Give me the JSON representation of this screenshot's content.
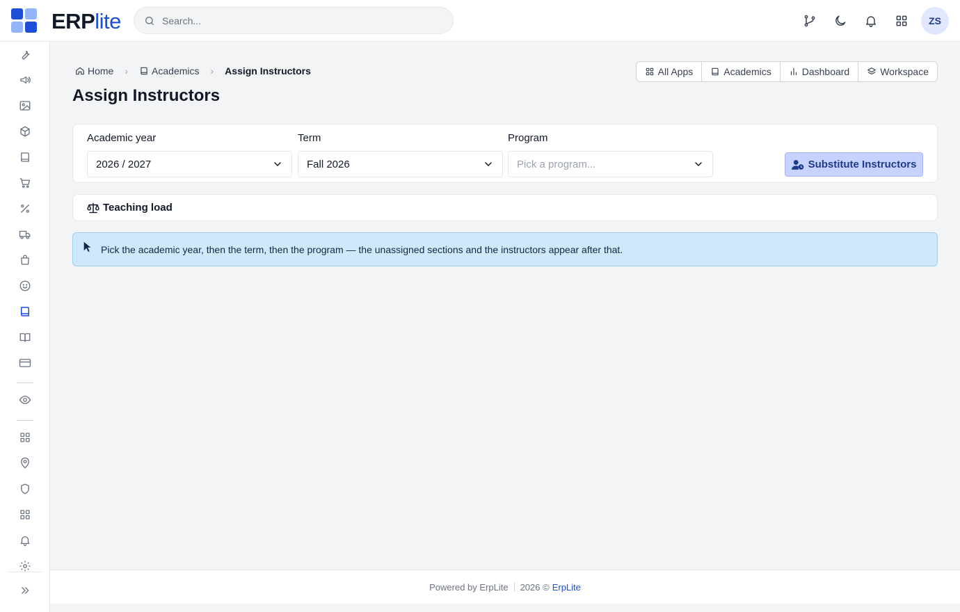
{
  "brand": {
    "name_bold": "ERP",
    "name_light": "lite",
    "logo_colors": [
      "#1d4ed8",
      "#93b4f8",
      "#93b4f8",
      "#1d4ed8"
    ]
  },
  "search": {
    "placeholder": "Search..."
  },
  "user": {
    "initials": "ZS"
  },
  "topbar_icons": [
    "git-branch-icon",
    "moon-icon",
    "bell-icon",
    "apps-grid-icon"
  ],
  "sidebar": {
    "items": [
      "wrench-icon",
      "megaphone-icon",
      "image-icon",
      "box-icon",
      "book-icon",
      "cart-icon",
      "percent-icon",
      "truck-icon",
      "shopping-bag-icon",
      "smile-icon",
      "book-icon",
      "book-open-icon",
      "credit-card-icon",
      "eye-icon",
      "grid-icon",
      "map-pin-icon",
      "shield-icon",
      "grid-icon",
      "bell-icon",
      "settings-icon",
      "expand-icon"
    ],
    "active_item": "book-icon",
    "active_color": "#1d4ed8"
  },
  "breadcrumb": {
    "home": "Home",
    "parent": "Academics",
    "current": "Assign Instructors"
  },
  "page": {
    "title": "Assign Instructors"
  },
  "app_switch": {
    "all_apps": "All Apps",
    "academics": "Academics",
    "dashboard": "Dashboard",
    "workspace": "Workspace"
  },
  "filters": {
    "academic_year": {
      "label": "Academic year",
      "value": "2026 / 2027"
    },
    "term": {
      "label": "Term",
      "value": "Fall 2026"
    },
    "program": {
      "label": "Program",
      "placeholder": "Pick a program..."
    },
    "substitute_button": "Substitute Instructors"
  },
  "teaching_load": {
    "label": "Teaching load"
  },
  "alert": {
    "message": "Pick the academic year, then the term, then the program — the unassigned sections and the instructors appear after that."
  },
  "footer": {
    "powered_by": "Powered by ErpLite",
    "copyright": "2026 ©",
    "link": "ErpLite"
  }
}
